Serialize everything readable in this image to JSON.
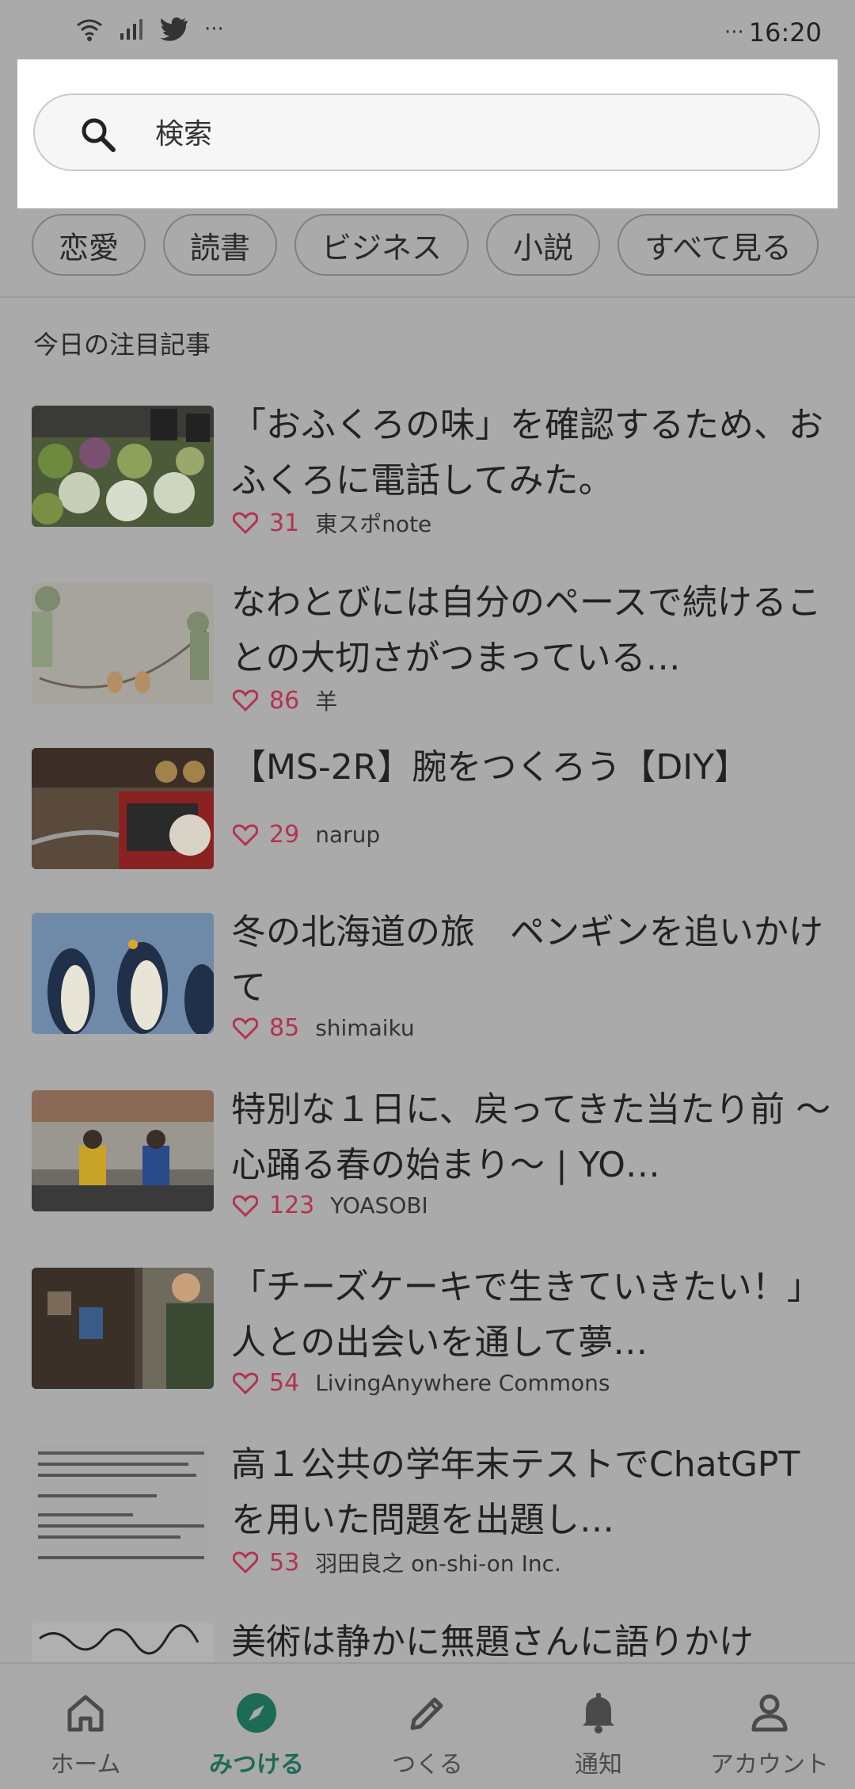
{
  "status_bar": {
    "time": "16:20",
    "more": "···",
    "time_prefix": "···"
  },
  "search": {
    "placeholder": "検索"
  },
  "chips": [
    "恋愛",
    "読書",
    "ビジネス",
    "小説",
    "すべて見る"
  ],
  "section_title": "今日の注目記事",
  "articles": [
    {
      "title": "「おふくろの味」を確認するため、おふくろに電話してみた。",
      "likes": "31",
      "author": "東スポnote",
      "thumb": "vegetables"
    },
    {
      "title": "なわとびには自分のペースで続けることの大切さがつまっている…",
      "likes": "86",
      "author": "羊",
      "thumb": "jump-rope-illustration"
    },
    {
      "title": "【MS-2R】腕をつくろう【DIY】",
      "likes": "29",
      "author": "narup",
      "thumb": "diy-tools"
    },
    {
      "title": "冬の北海道の旅　ペンギンを追いかけて",
      "likes": "85",
      "author": "shimaiku",
      "thumb": "penguins"
    },
    {
      "title": "特別な１日に、戻ってきた当たり前 〜心踊る春の始まり〜 | YO…",
      "likes": "123",
      "author": "YOASOBI",
      "thumb": "concert-crowd"
    },
    {
      "title": "「チーズケーキで生きていきたい！」人との出会いを通して夢…",
      "likes": "54",
      "author": "LivingAnywhere Commons",
      "thumb": "cafe"
    },
    {
      "title": "高１公共の学年末テストでChatGPTを用いた問題を出題し…",
      "likes": "53",
      "author": "羽田良之 on-shi-on Inc.",
      "thumb": "text-document"
    },
    {
      "title": "美術は静かに無題さんに語りかけ",
      "likes": "",
      "author": "",
      "thumb": "handwritten-note"
    }
  ],
  "bottom_nav": [
    {
      "label": "ホーム",
      "icon": "home-icon",
      "active": false
    },
    {
      "label": "みつける",
      "icon": "compass-icon",
      "active": true
    },
    {
      "label": "つくる",
      "icon": "pencil-icon",
      "active": false
    },
    {
      "label": "通知",
      "icon": "bell-icon",
      "active": false
    },
    {
      "label": "アカウント",
      "icon": "person-icon",
      "active": false
    }
  ],
  "colors": {
    "accent": "#1e6b55",
    "like": "#b3334f",
    "overlay": "#aaaaaa"
  }
}
